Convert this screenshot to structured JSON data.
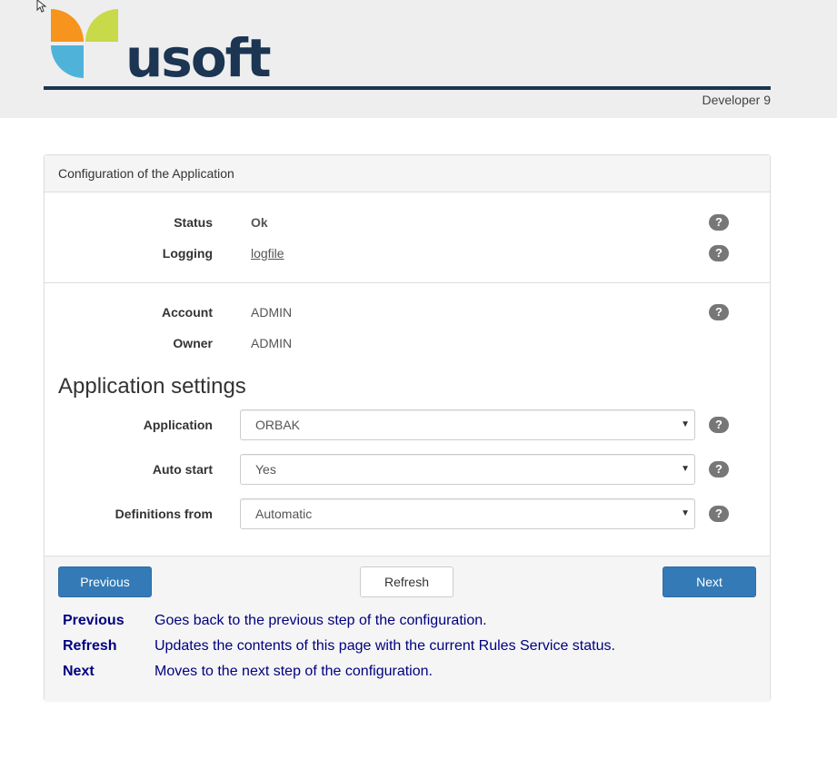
{
  "header": {
    "logo_text": "usoft",
    "version": "Developer 9"
  },
  "panel": {
    "title": "Configuration of the Application",
    "status": {
      "label": "Status",
      "value": "Ok"
    },
    "logging": {
      "label": "Logging",
      "value": "logfile"
    },
    "account": {
      "label": "Account",
      "value": "ADMIN"
    },
    "owner": {
      "label": "Owner",
      "value": "ADMIN"
    },
    "help_glyph": "?"
  },
  "settings": {
    "title": "Application settings",
    "application": {
      "label": "Application",
      "value": "ORBAK"
    },
    "auto_start": {
      "label": "Auto start",
      "value": "Yes"
    },
    "definitions": {
      "label": "Definitions from",
      "value": "Automatic"
    }
  },
  "footer": {
    "previous_label": "Previous",
    "refresh_label": "Refresh",
    "next_label": "Next",
    "help": [
      {
        "key": "Previous",
        "desc": "Goes back to the previous step of the configuration."
      },
      {
        "key": "Refresh",
        "desc": "Updates the contents of this page with the current Rules Service status."
      },
      {
        "key": "Next",
        "desc": "Moves to the next step of the configuration."
      }
    ]
  },
  "colors": {
    "brand_navy": "#1b3553",
    "primary": "#337ab7",
    "ok": "#3c763d",
    "orange": "#f7941d",
    "lime": "#c8d94a",
    "cyan": "#4fb3d9"
  }
}
